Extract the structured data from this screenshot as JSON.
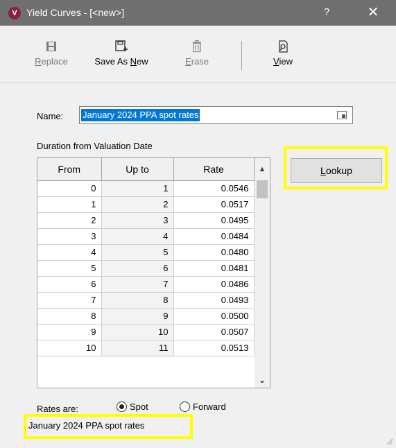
{
  "window": {
    "app_icon_letter": "V",
    "title": "Yield Curves - [<new>]",
    "help": "?",
    "close": "✕"
  },
  "toolbar": {
    "replace_label": "Replace",
    "save_as_new_label": "Save As New",
    "erase_label": "Erase",
    "view_label": "View"
  },
  "form": {
    "name_label": "Name:",
    "name_value": "January 2024 PPA spot rates",
    "duration_label": "Duration from Valuation Date",
    "lookup_label": "Lookup",
    "rates_are_label": "Rates are:",
    "spot_label": "Spot",
    "forward_label": "Forward",
    "selected_rate_type": "Spot",
    "status_text": "January 2024 PPA spot rates"
  },
  "grid": {
    "columns": [
      "From",
      "Up to",
      "Rate"
    ],
    "rows": [
      [
        "0",
        "1",
        "0.0546"
      ],
      [
        "1",
        "2",
        "0.0517"
      ],
      [
        "2",
        "3",
        "0.0495"
      ],
      [
        "3",
        "4",
        "0.0484"
      ],
      [
        "4",
        "5",
        "0.0480"
      ],
      [
        "5",
        "6",
        "0.0481"
      ],
      [
        "6",
        "7",
        "0.0486"
      ],
      [
        "7",
        "8",
        "0.0493"
      ],
      [
        "8",
        "9",
        "0.0500"
      ],
      [
        "9",
        "10",
        "0.0507"
      ],
      [
        "10",
        "11",
        "0.0513"
      ]
    ]
  },
  "colors": {
    "highlight": "#ffff00",
    "titlebar": "#6f6f6f",
    "selection": "#0078d7"
  }
}
